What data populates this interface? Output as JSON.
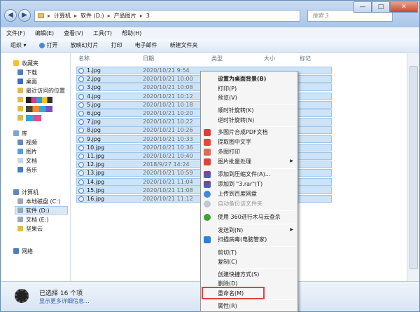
{
  "titlebar": {
    "path": [
      "计算机",
      "软件 (D:)",
      "产品图片",
      "3"
    ],
    "search_placeholder": "搜索 3",
    "minimize": "—",
    "maximize": "□",
    "close": "✕"
  },
  "menu": [
    "文件(F)",
    "编辑(E)",
    "查看(V)",
    "工具(T)",
    "帮助(H)"
  ],
  "toolbar": [
    "组织 ▾",
    "打开",
    "放映幻灯片",
    "打印",
    "电子邮件",
    "新建文件夹"
  ],
  "sidebar": {
    "favorites": "收藏夹",
    "downloads": "下载",
    "desktop": "桌面",
    "recent": "最近访问的位置",
    "library": "库",
    "video": "视频",
    "pictures": "图片",
    "documents": "文档",
    "music": "音乐",
    "computer": "计算机",
    "disk_c": "本地磁盘 (C:)",
    "disk_d": "软件 (D:)",
    "disk_e": "文档 (E:)",
    "cloud": "坚果云",
    "network": "网络"
  },
  "columns": {
    "name": "名称",
    "date": "日期",
    "type": "类型",
    "size": "大小",
    "tags": "标记"
  },
  "files": [
    {
      "name": "1.jpg",
      "date": "2020/10/21 9:54"
    },
    {
      "name": "2.jpg",
      "date": "2020/10/21 10:00"
    },
    {
      "name": "3.jpg",
      "date": "2020/10/21 10:08"
    },
    {
      "name": "4.jpg",
      "date": "2020/10/21 10:12"
    },
    {
      "name": "5.jpg",
      "date": "2020/10/21 10:18"
    },
    {
      "name": "6.jpg",
      "date": "2020/10/21 10:20"
    },
    {
      "name": "7.jpg",
      "date": "2020/10/21 10:22"
    },
    {
      "name": "8.jpg",
      "date": "2020/10/21 10:26"
    },
    {
      "name": "9.jpg",
      "date": "2020/10/21 10:33"
    },
    {
      "name": "10.jpg",
      "date": "2020/10/21 10:36"
    },
    {
      "name": "11.jpg",
      "date": "2020/10/21 10:40"
    },
    {
      "name": "12.jpg",
      "date": "2018/9/27 14:24"
    },
    {
      "name": "13.jpg",
      "date": "2020/10/21 10:59"
    },
    {
      "name": "14.jpg",
      "date": "2020/10/21 11:04"
    },
    {
      "name": "15.jpg",
      "date": "2020/10/21 11:08"
    },
    {
      "name": "16.jpg",
      "date": "2020/10/21 11:12"
    }
  ],
  "status": {
    "selected": "已选择 16 个项",
    "details": "显示更多详细信息..."
  },
  "context_menu": {
    "set_wallpaper": "设置为桌面背景(B)",
    "print": "打印(P)",
    "preview": "预览(V)",
    "rotate_cw": "顺时针旋转(K)",
    "rotate_ccw": "逆时针旋转(N)",
    "merge_pdf": "多图片合成PDF文档",
    "extract_text": "提取图中文字",
    "multi_print": "多图打印",
    "batch": "图片批量处理",
    "add_archive": "添加到压缩文件(A)...",
    "add_rar": "添加到 \"3.rar\"(T)",
    "upload_baidu": "上传到百度网盘",
    "auto_backup": "自动备份该文件夹",
    "scan_360": "使用 360进行木马云查杀",
    "send_to": "发送到(N)",
    "scan_tencent": "扫描病毒(电脑管家)",
    "cut": "剪切(T)",
    "copy": "复制(C)",
    "shortcut": "创建快捷方式(S)",
    "delete": "删除(D)",
    "rename": "重命名(M)",
    "properties": "属性(R)"
  }
}
